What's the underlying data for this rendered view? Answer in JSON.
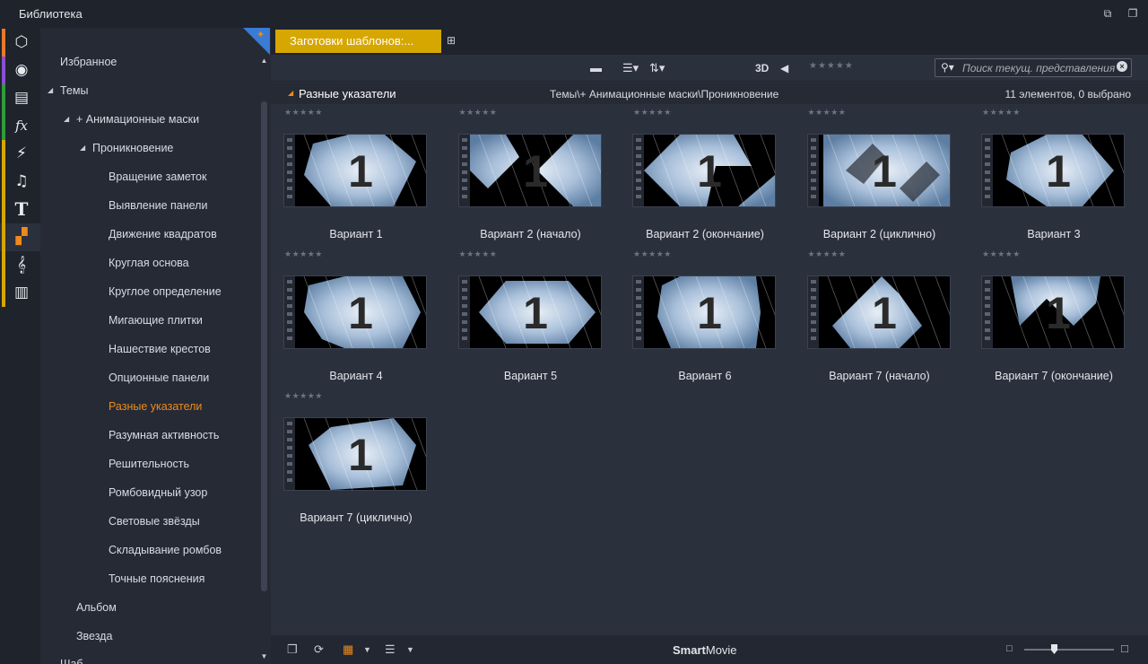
{
  "window": {
    "title": "Библиотека"
  },
  "rail": {
    "items": [
      {
        "name": "project-bin-icon",
        "stripe": "#e8792a",
        "glyph": "⬡"
      },
      {
        "name": "video-reel-icon",
        "stripe": "#8a4fd1",
        "glyph": "◉"
      },
      {
        "name": "photos-icon",
        "stripe": "#2e9d3a",
        "glyph": "▤"
      },
      {
        "name": "effects-fx-icon",
        "stripe": "#2e9d3a",
        "glyph": "fx"
      },
      {
        "name": "transitions-icon",
        "stripe": "#d6a700",
        "glyph": "⚡"
      },
      {
        "name": "music-icon",
        "stripe": "#d6a700",
        "glyph": "♫"
      },
      {
        "name": "titles-icon",
        "stripe": "#d6a700",
        "glyph": "T"
      },
      {
        "name": "montage-templates-icon",
        "stripe": "#d6a700",
        "glyph": "▞",
        "active": true
      },
      {
        "name": "scorefitter-icon",
        "stripe": "#d6a700",
        "glyph": "𝄞"
      },
      {
        "name": "piano-icon",
        "stripe": "#d6a700",
        "glyph": "▥"
      }
    ]
  },
  "tree": {
    "favorites": "Избранное",
    "themes": "Темы",
    "anim_masks": "+ Анимационные маски",
    "penetration": "Проникновение",
    "items": [
      "Вращение заметок",
      "Выявление панели",
      "Движение квадратов",
      "Круглая основа",
      "Круглое определение",
      "Мигающие плитки",
      "Нашествие крестов",
      "Опционные панели",
      "Разные указатели",
      "Разумная активность",
      "Решительность",
      "Ромбовидный узор",
      "Световые звёзды",
      "Складывание ромбов",
      "Точные пояснения"
    ],
    "selected_index": 8,
    "album": "Альбом",
    "star": "Звезда",
    "cut_off": "Шаб…"
  },
  "tabs": {
    "active": "Заготовки шаблонов:..."
  },
  "toolbar": {
    "label_3d": "3D",
    "stars": "★★★★★",
    "search_placeholder": "Поиск текущ. представления"
  },
  "pathbar": {
    "group": "Разные указатели",
    "path": "Темы\\+ Анимационные маски\\Проникновение",
    "count": "11 элементов, 0 выбрано"
  },
  "grid": {
    "rating": "★★★★★",
    "items": [
      {
        "label": "Вариант 1",
        "variant": 0
      },
      {
        "label": "Вариант 2 (начало)",
        "variant": 1
      },
      {
        "label": "Вариант 2 (окончание)",
        "variant": 2
      },
      {
        "label": "Вариант 2 (циклично)",
        "variant": 3
      },
      {
        "label": "Вариант 3",
        "variant": 4
      },
      {
        "label": "Вариант 4",
        "variant": 5
      },
      {
        "label": "Вариант 5",
        "variant": 6
      },
      {
        "label": "Вариант 6",
        "variant": 7
      },
      {
        "label": "Вариант 7 (начало)",
        "variant": 8
      },
      {
        "label": "Вариант 7 (окончание)",
        "variant": 9
      },
      {
        "label": "Вариант 7 (циклично)",
        "variant": 10
      }
    ],
    "thumb_digit": "1"
  },
  "footer": {
    "brand_bold": "Smart",
    "brand_rest": "Movie"
  },
  "colors": {
    "accent": "#f08a1c",
    "tab": "#d6a700",
    "pin": "#3a7bd5"
  }
}
